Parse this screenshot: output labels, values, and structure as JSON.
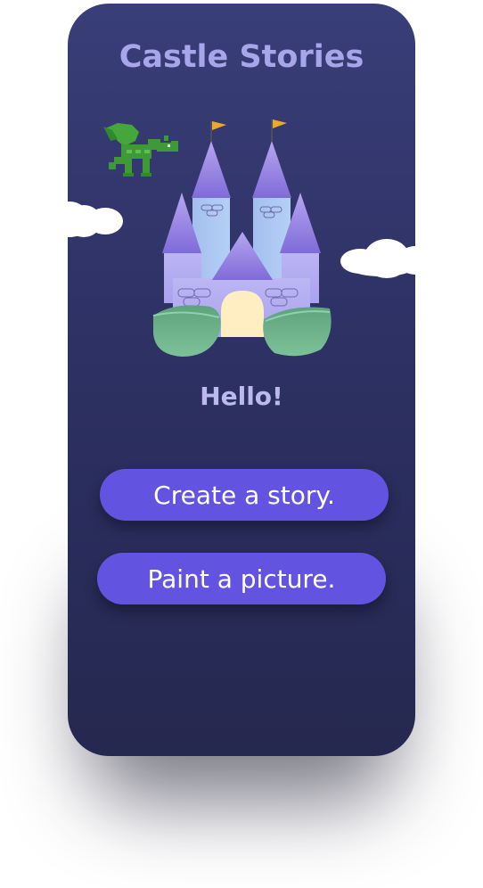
{
  "app": {
    "title": "Castle Stories",
    "greeting": "Hello!"
  },
  "actions": {
    "create_story_label": "Create a story.",
    "paint_picture_label": "Paint a picture."
  },
  "illustration": {
    "icons": [
      "dragon-icon",
      "castle-icon",
      "cloud-icon",
      "flag-icon",
      "bush-icon"
    ]
  },
  "colors": {
    "background_top": "#393e78",
    "background_bottom": "#25284f",
    "title": "#a8a6ea",
    "greeting": "#bcb9f0",
    "button": "#6254e0",
    "button_text": "#ffffff",
    "castle_wall": "#b2adf0",
    "castle_roof": "#8b78dc",
    "tower": "#a9c6f2",
    "door": "#ffeec2",
    "bush": "#6fb38e",
    "dragon": "#3e9a37",
    "flag": "#f0a82a",
    "cloud": "#ffffff"
  }
}
